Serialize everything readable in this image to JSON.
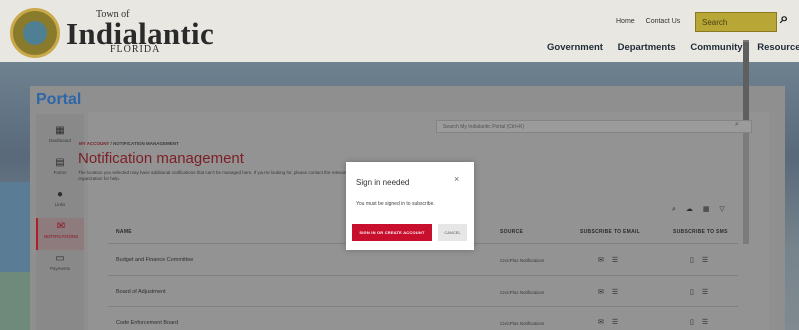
{
  "site": {
    "town_of": "Town of",
    "town_name": "Indialantic",
    "state": "FLORIDA",
    "top_links": [
      "Home",
      "Contact Us"
    ],
    "search_placeholder": "Search",
    "nav": [
      "Government",
      "Departments",
      "Community",
      "Resources"
    ]
  },
  "portal": {
    "title": "Portal",
    "left_nav": [
      {
        "label": "Dashboard",
        "icon": "dashboard-icon"
      },
      {
        "label": "Forms",
        "icon": "forms-icon"
      },
      {
        "label": "Links",
        "icon": "links-icon"
      },
      {
        "label": "NOTIFICATIONS",
        "icon": "notifications-icon",
        "active": true
      },
      {
        "label": "Payments",
        "icon": "payments-icon"
      }
    ],
    "search_placeholder": "Search My Indialantic Portal (Ctrl+K)",
    "breadcrumb": [
      "MY ACCOUNT",
      "NOTIFICATION MANAGEMENT"
    ],
    "breadcrumb_sep": "/",
    "page_title": "Notification management",
    "description": "The location you selected may have additional notifications that can't be managed here. If you're looking for, please contact the relevant organization for help."
  },
  "table": {
    "headers": [
      "NAME",
      "SOURCE",
      "SUBSCRIBE TO EMAIL",
      "SUBSCRIBE TO SMS"
    ],
    "rows": [
      {
        "name": "Budget and Finance Committee",
        "source": "CivicPlus Notifications"
      },
      {
        "name": "Board of Adjustment",
        "source": "CivicPlus Notifications"
      },
      {
        "name": "Code Enforcement Board",
        "source": "CivicPlus Notifications"
      }
    ]
  },
  "modal": {
    "title": "Sign in needed",
    "close": "×",
    "message": "You must be signed in to subscribe.",
    "primary_button": "SIGN IN OR CREATE ACCOUNT",
    "secondary_button": "CANCEL"
  },
  "colors": {
    "accent_red": "#c8102e",
    "portal_blue": "#2e66a8",
    "search_gold": "#b8a637"
  }
}
